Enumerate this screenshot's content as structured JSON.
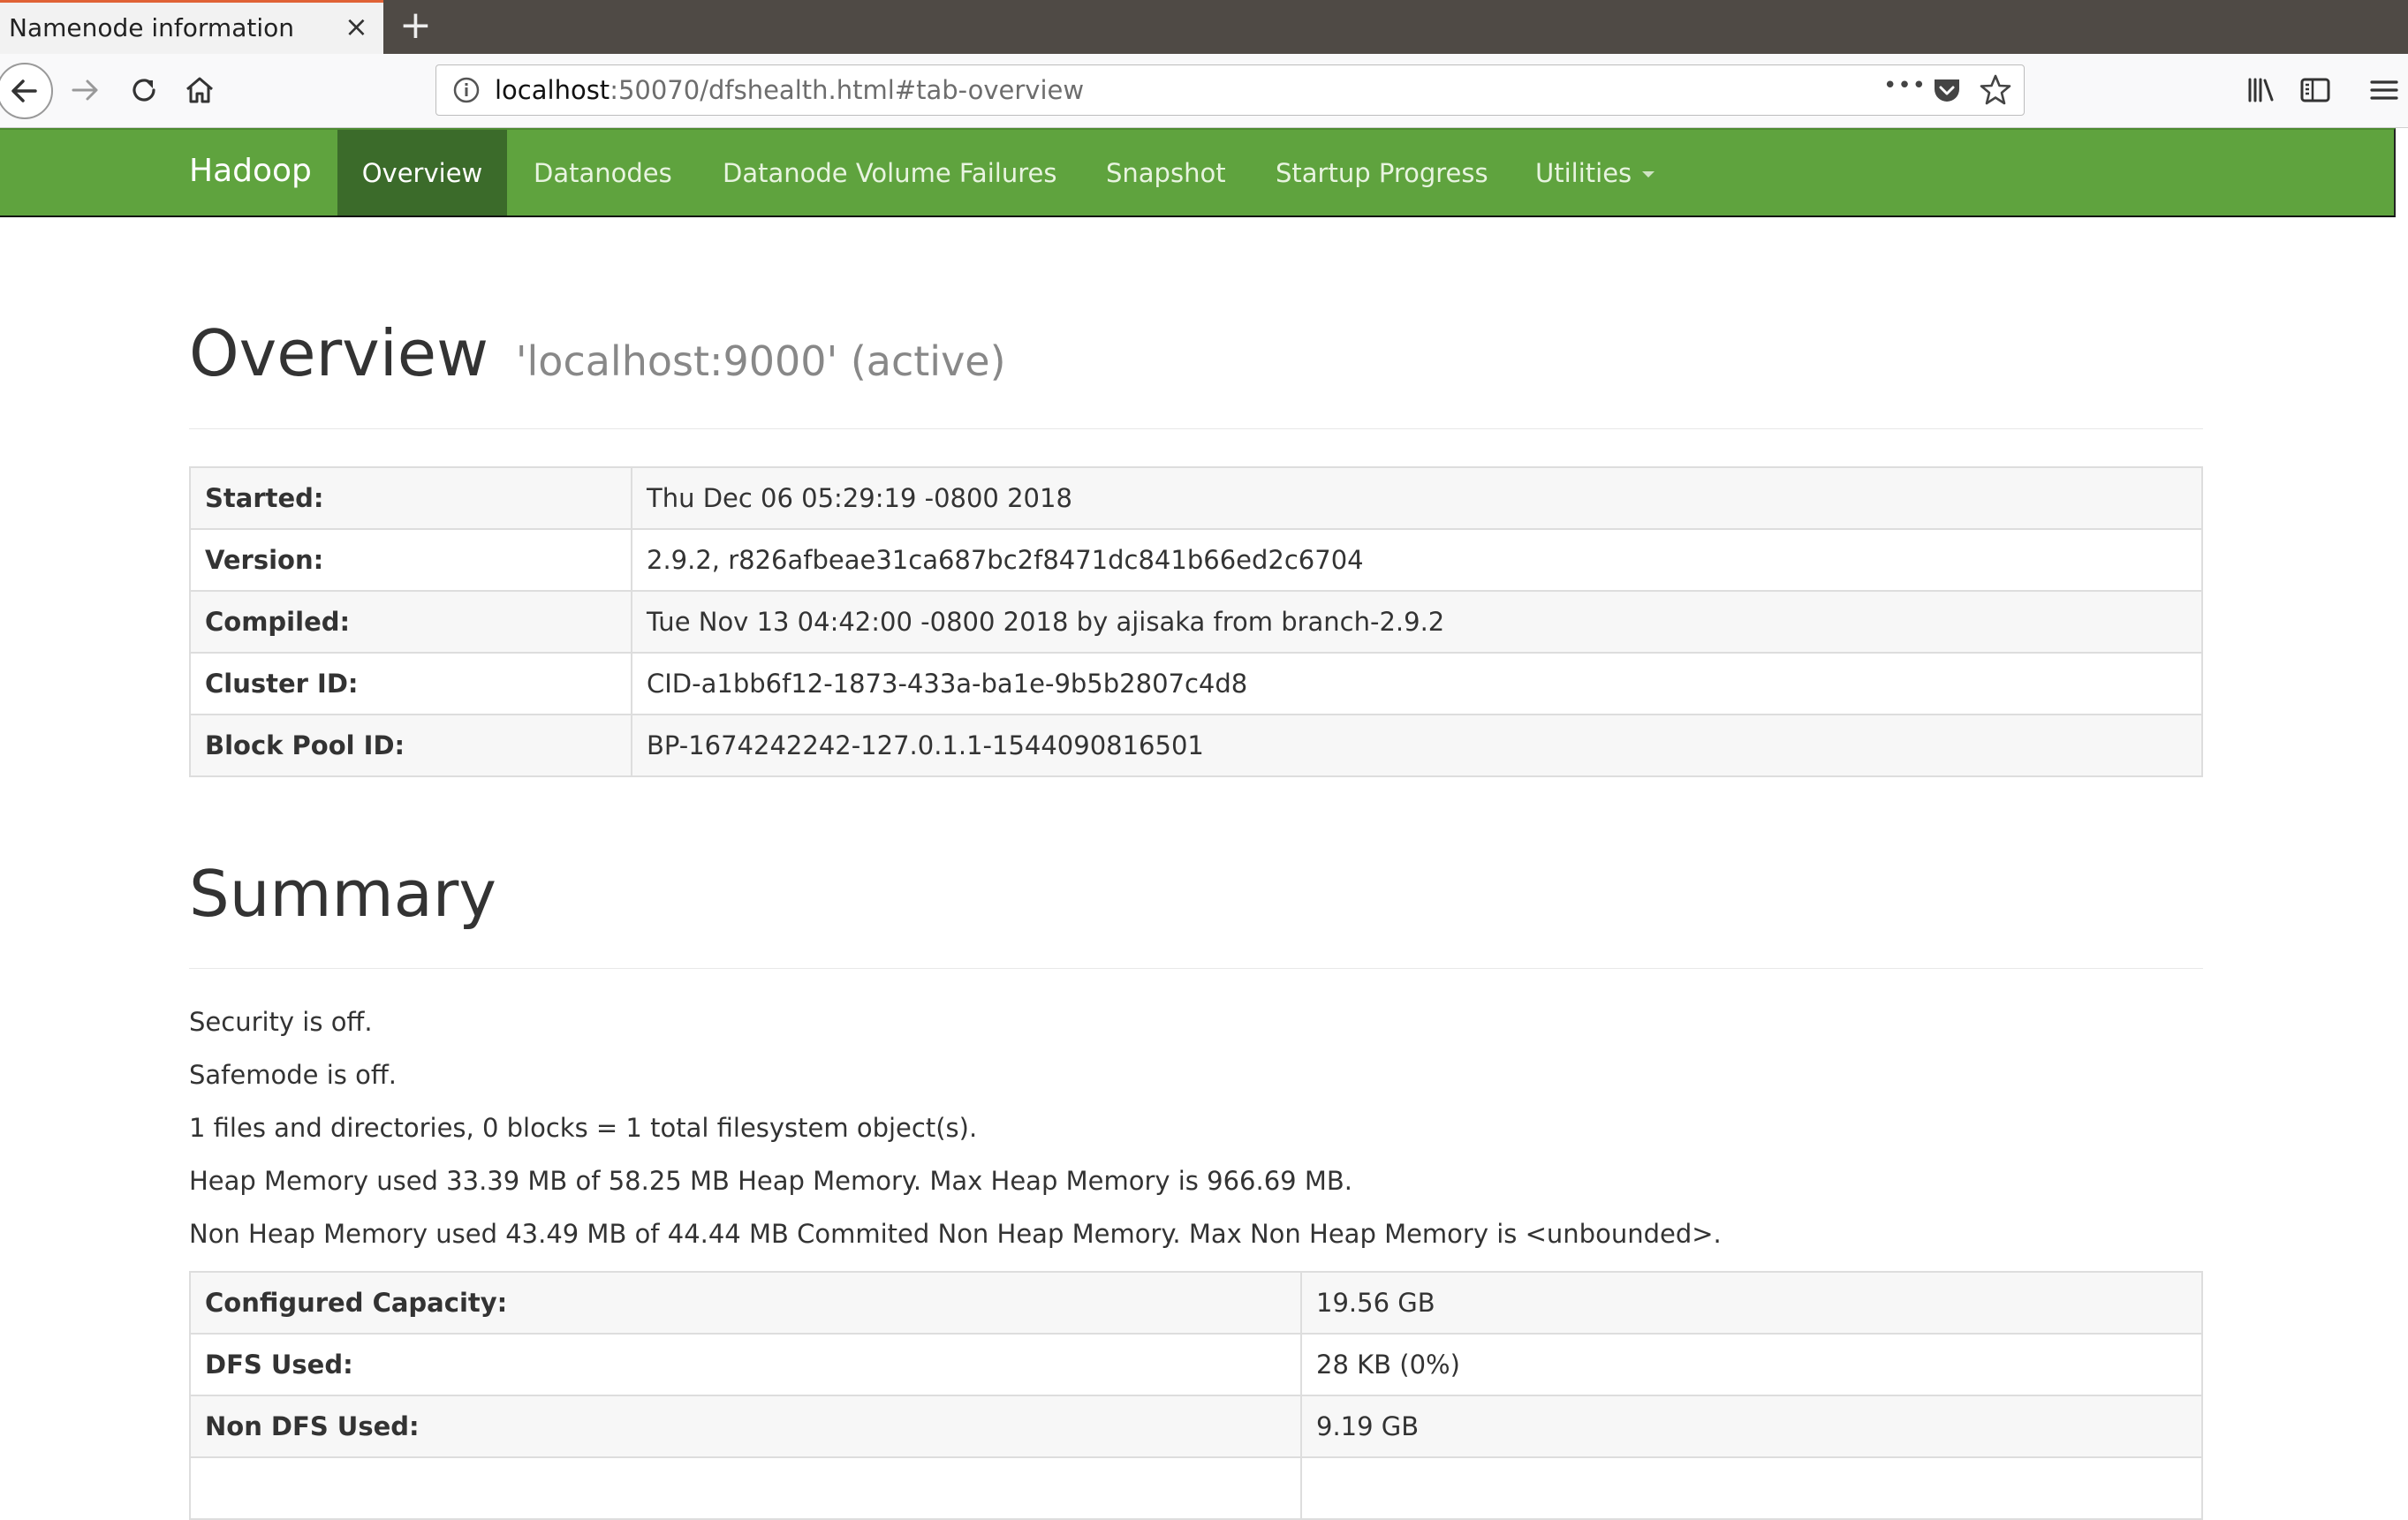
{
  "browser": {
    "tab_title": "Namenode information",
    "tab_close_glyph": "×",
    "new_tab_glyph": "+",
    "url_host": "localhost",
    "url_rest": ":50070/dfshealth.html#tab-overview",
    "more_glyph": "•••"
  },
  "navbar": {
    "brand": "Hadoop",
    "items": [
      {
        "label": "Overview",
        "active": true
      },
      {
        "label": "Datanodes"
      },
      {
        "label": "Datanode Volume Failures"
      },
      {
        "label": "Snapshot"
      },
      {
        "label": "Startup Progress"
      },
      {
        "label": "Utilities",
        "dropdown": true
      }
    ]
  },
  "overview": {
    "title": "Overview",
    "subtitle": "'localhost:9000' (active)",
    "rows": [
      {
        "key": "Started:",
        "value": "Thu Dec 06 05:29:19 -0800 2018"
      },
      {
        "key": "Version:",
        "value": "2.9.2, r826afbeae31ca687bc2f8471dc841b66ed2c6704"
      },
      {
        "key": "Compiled:",
        "value": "Tue Nov 13 04:42:00 -0800 2018 by ajisaka from branch-2.9.2"
      },
      {
        "key": "Cluster ID:",
        "value": "CID-a1bb6f12-1873-433a-ba1e-9b5b2807c4d8"
      },
      {
        "key": "Block Pool ID:",
        "value": "BP-1674242242-127.0.1.1-1544090816501"
      }
    ]
  },
  "summary": {
    "title": "Summary",
    "lines": [
      "Security is off.",
      "Safemode is off.",
      "1 files and directories, 0 blocks = 1 total filesystem object(s).",
      "Heap Memory used 33.39 MB of 58.25 MB Heap Memory. Max Heap Memory is 966.69 MB.",
      "Non Heap Memory used 43.49 MB of 44.44 MB Commited Non Heap Memory. Max Non Heap Memory is <unbounded>."
    ],
    "rows": [
      {
        "key": "Configured Capacity:",
        "value": "19.56 GB"
      },
      {
        "key": "DFS Used:",
        "value": "28 KB (0%)"
      },
      {
        "key": "Non DFS Used:",
        "value": "9.19 GB"
      },
      {
        "key": "",
        "value": ""
      }
    ]
  },
  "colors": {
    "navbar": "#5fa33e",
    "navbar_active": "#3b6b2a",
    "tab_accent": "#e06236"
  }
}
